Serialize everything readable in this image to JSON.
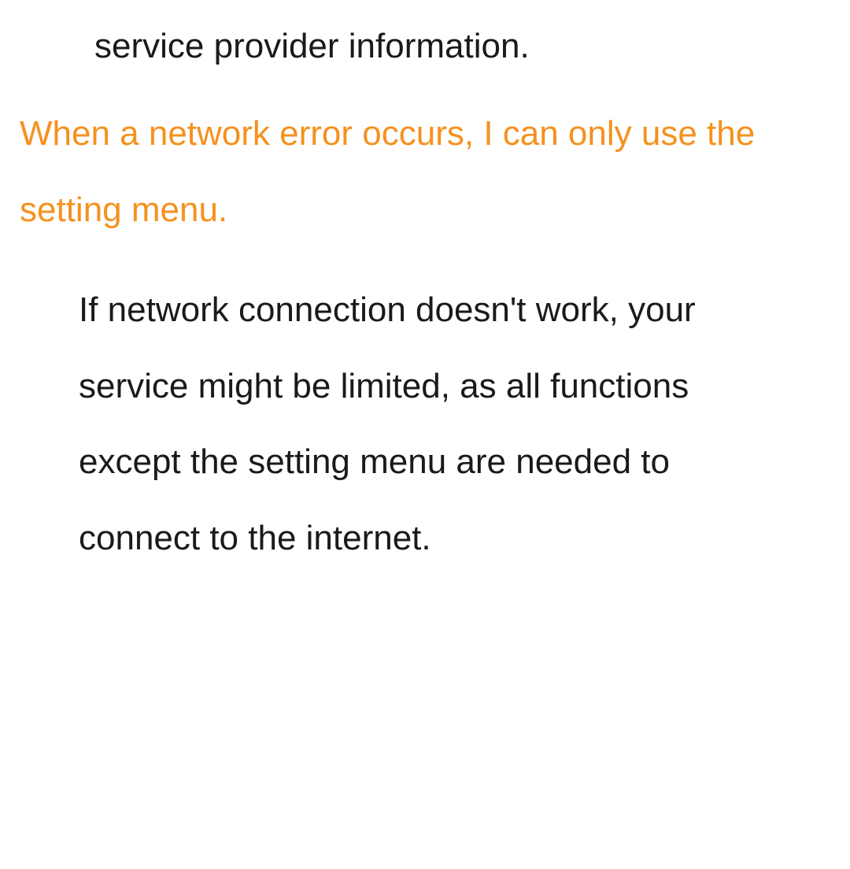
{
  "fragment": "service provider information.",
  "heading": "When a network error occurs, I can only use the setting menu.",
  "body": "If network connection doesn't work, your service might be limited, as all functions except the setting menu are needed to connect to the internet."
}
